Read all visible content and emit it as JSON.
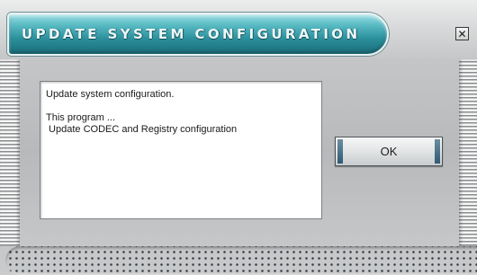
{
  "window": {
    "title": "Update system configuration",
    "close_glyph": "✕",
    "accent": "#2b8f9b"
  },
  "message": {
    "lines": [
      "Update system configuration.",
      "",
      "This program ...",
      " Update CODEC and Registry configuration"
    ]
  },
  "buttons": {
    "ok_label": "OK"
  },
  "icons": {
    "close": "close-icon"
  }
}
